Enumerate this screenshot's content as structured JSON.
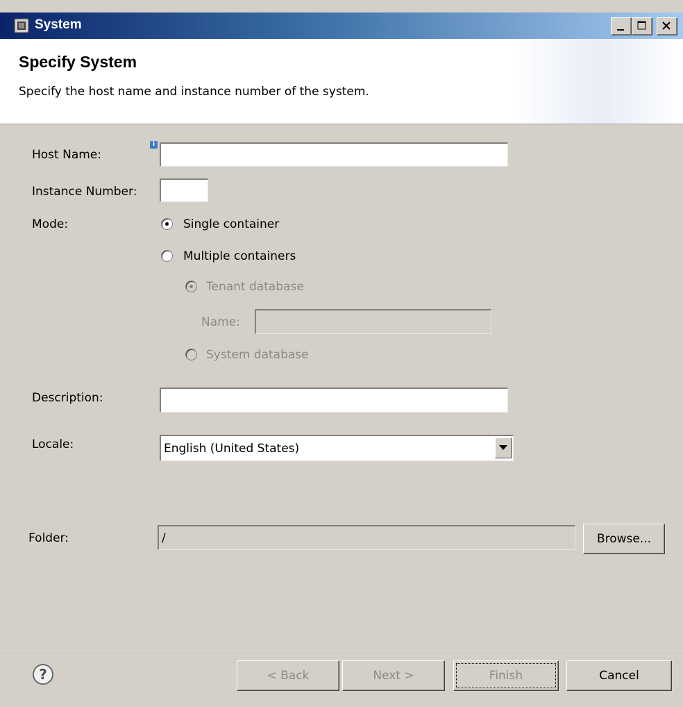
{
  "window": {
    "title": "System",
    "controls": [
      "minimize-icon",
      "maximize-icon",
      "close-icon"
    ]
  },
  "header": {
    "title": "Specify System",
    "description": "Specify the host name and instance number of the system."
  },
  "form": {
    "host_name": {
      "label": "Host Name:",
      "value": "",
      "info_icon": "info-icon"
    },
    "instance_number": {
      "label": "Instance Number:",
      "value": ""
    },
    "mode": {
      "label": "Mode:",
      "options": [
        {
          "label": "Single container",
          "selected": true,
          "enabled": true
        },
        {
          "label": "Multiple containers",
          "selected": false,
          "enabled": true
        }
      ],
      "sub_options": {
        "tenant_database": {
          "label": "Tenant database",
          "selected": true,
          "enabled": false
        },
        "name": {
          "label": "Name:",
          "value": "",
          "enabled": false
        },
        "system_database": {
          "label": "System database",
          "selected": false,
          "enabled": false
        }
      }
    },
    "description": {
      "label": "Description:",
      "value": ""
    },
    "locale": {
      "label": "Locale:",
      "selected": "English (United States)"
    },
    "folder": {
      "label": "Folder:",
      "value": "/",
      "browse_label": "Browse..."
    }
  },
  "footer": {
    "help_icon": "help-icon",
    "back_label": "< Back",
    "next_label": "Next >",
    "finish_label": "Finish",
    "cancel_label": "Cancel"
  }
}
